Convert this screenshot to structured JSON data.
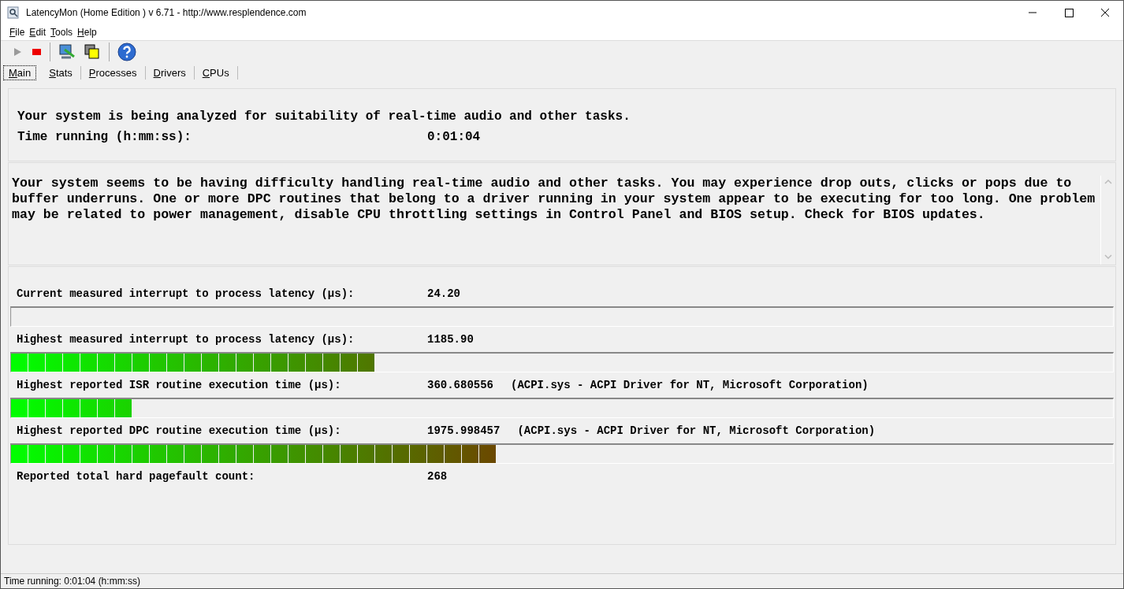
{
  "window": {
    "title": "LatencyMon  (Home Edition )  v 6.71 - http://www.resplendence.com"
  },
  "menu": [
    "File",
    "Edit",
    "Tools",
    "Help"
  ],
  "tabs": [
    {
      "label": "Main",
      "selected": true
    },
    {
      "label": "Stats",
      "selected": false
    },
    {
      "label": "Processes",
      "selected": false
    },
    {
      "label": "Drivers",
      "selected": false
    },
    {
      "label": "CPUs",
      "selected": false
    }
  ],
  "status_panel": {
    "heading": "Your system is being analyzed for suitability of real-time audio and other tasks.",
    "time_label": "Time running (h:mm:ss):",
    "time_value": "0:01:04"
  },
  "verdict": "Your system seems to be having difficulty handling real-time audio and other tasks. You may experience drop outs, clicks or pops due to buffer underruns. One or more DPC routines that belong to a driver running in your system appear to be executing for too long. One problem may be related to power management, disable CPU throttling settings in Control Panel and BIOS setup. Check for BIOS updates.",
  "measurements": [
    {
      "kind": "readout",
      "label": "Current measured interrupt to process latency (µs):",
      "value": "24.20"
    },
    {
      "kind": "bar",
      "level": 0
    },
    {
      "kind": "readout",
      "label": "Highest measured interrupt to process latency (µs):",
      "value": "1185.90"
    },
    {
      "kind": "bar",
      "level": 0.33
    },
    {
      "kind": "readout",
      "label": "Highest reported ISR routine execution time (µs):",
      "value": "360.680556",
      "detail": "(ACPI.sys - ACPI Driver for NT, Microsoft Corporation)"
    },
    {
      "kind": "bar",
      "level": 0.11
    },
    {
      "kind": "readout",
      "label": "Highest reported DPC routine execution time (µs):",
      "value": "1975.998457",
      "detail": "(ACPI.sys - ACPI Driver for NT, Microsoft Corporation)"
    },
    {
      "kind": "bar",
      "level": 0.44
    },
    {
      "kind": "readout",
      "label": "Reported total hard pagefault count:",
      "value": "268"
    }
  ],
  "status_bar": "Time running: 0:01:04  (h:mm:ss)"
}
